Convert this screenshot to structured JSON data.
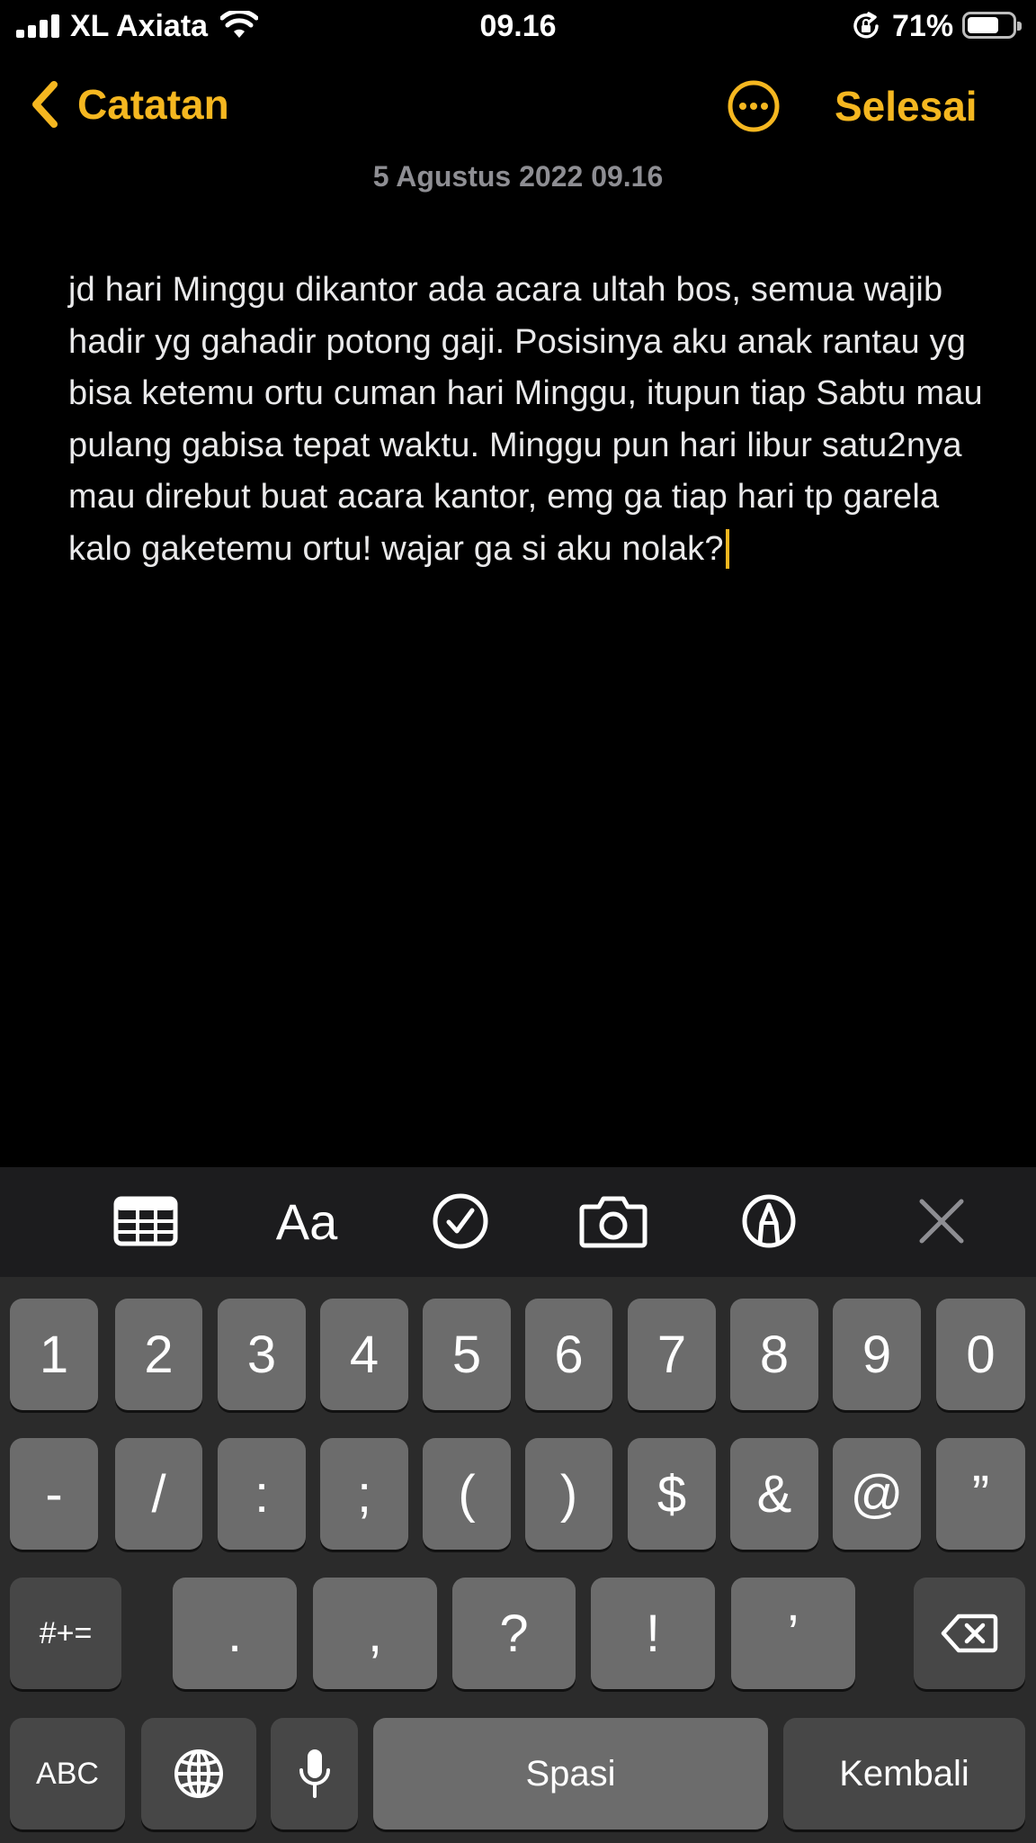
{
  "status_bar": {
    "carrier": "XL Axiata",
    "time": "09.16",
    "battery_percent_label": "71%",
    "battery_level": 0.71
  },
  "nav": {
    "back_label": "Catatan",
    "done_label": "Selesai"
  },
  "note": {
    "date": "5 Agustus 2022 09.16",
    "body": "jd hari Minggu dikantor ada acara ultah bos, semua wajib hadir yg gahadir potong gaji. Posisinya aku anak rantau yg bisa ketemu ortu cuman hari Minggu, itupun tiap Sabtu mau pulang gabisa tepat waktu. Minggu pun hari libur satu2nya mau direbut buat acara kantor, emg ga tiap hari tp garela kalo gaketemu ortu! wajar ga si aku nolak?"
  },
  "toolbar": {
    "format_label": "Aa",
    "icons": [
      "table-icon",
      "format-text",
      "checklist-icon",
      "camera-icon",
      "markup-icon",
      "close-icon"
    ]
  },
  "keyboard": {
    "row1": [
      "1",
      "2",
      "3",
      "4",
      "5",
      "6",
      "7",
      "8",
      "9",
      "0"
    ],
    "row2": [
      "-",
      "/",
      ":",
      ";",
      "(",
      ")",
      "$",
      "&",
      "@",
      "”"
    ],
    "row3_shift": "#+=",
    "row3": [
      ".",
      ",",
      "?",
      "!",
      "’"
    ],
    "abc_label": "ABC",
    "space_label": "Spasi",
    "return_label": "Kembali"
  },
  "colors": {
    "accent": "#f5b720",
    "background": "#000000",
    "toolbar": "#1c1c1e",
    "keyboard": "#2b2b2b",
    "key": "#6c6c6c",
    "key_dark": "#474747"
  }
}
